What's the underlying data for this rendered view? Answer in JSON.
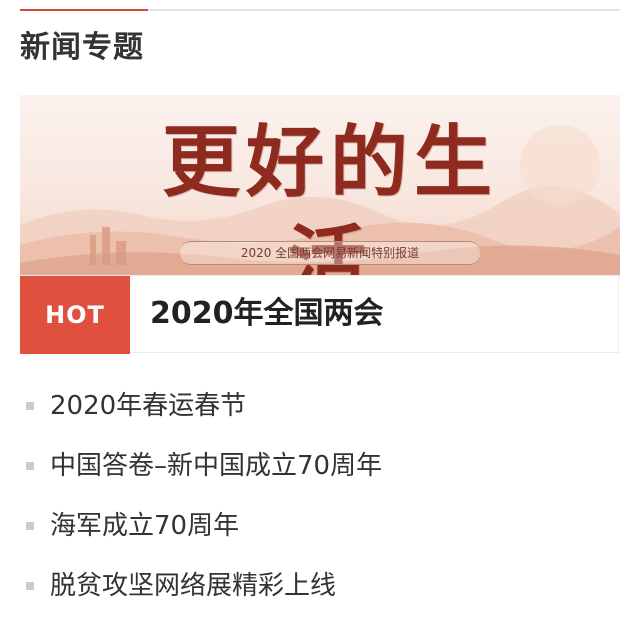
{
  "section": {
    "title": "新闻专题"
  },
  "banner": {
    "title": "更好的生活",
    "subtitle": "2020 全国两会网易新闻特别报道"
  },
  "featured": {
    "badge": "HOT",
    "title": "2020年全国两会"
  },
  "topics": [
    {
      "label": "2020年春运春节"
    },
    {
      "label": "中国答卷–新中国成立70周年"
    },
    {
      "label": "海军成立70周年"
    },
    {
      "label": "脱贫攻坚网络展精彩上线"
    }
  ],
  "colors": {
    "accent": "#d9473a",
    "hot_badge": "#e0503f",
    "bullet": "#cccccc",
    "text": "#333333"
  }
}
